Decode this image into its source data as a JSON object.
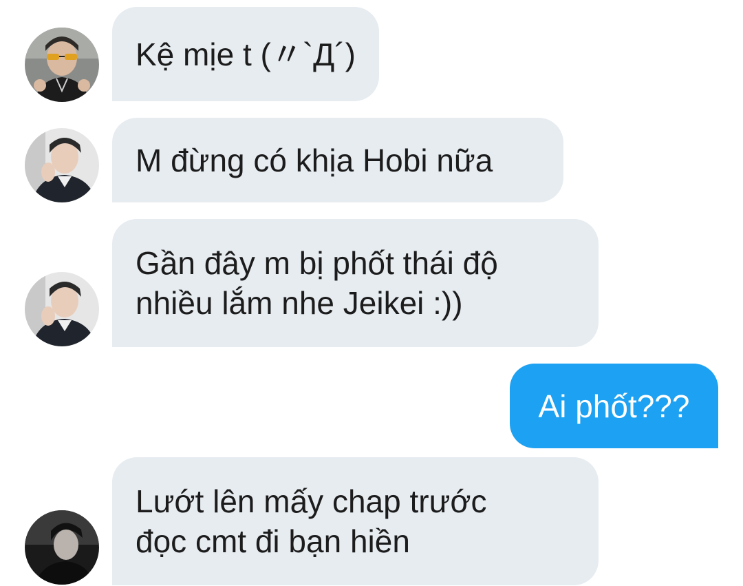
{
  "conversation": {
    "messages": [
      {
        "direction": "incoming",
        "avatar_icon": "avatar-user-glasses-icon",
        "text": "Kệ mịe t (〃`Д´)"
      },
      {
        "direction": "incoming",
        "avatar_icon": "avatar-user-suit-icon",
        "text": "M đừng có khịa Hobi nữa"
      },
      {
        "direction": "incoming",
        "avatar_icon": "avatar-user-suit-icon",
        "text": "Gần đây m bị phốt thái độ\nnhiều lắm nhe Jeikei :))"
      },
      {
        "direction": "outgoing",
        "text": "Ai phốt???"
      },
      {
        "direction": "incoming",
        "avatar_icon": "avatar-user-dark-icon",
        "text": "Lướt lên mấy chap trước\nđọc cmt đi bạn hiền"
      }
    ]
  },
  "colors": {
    "incoming_bubble": "#e7ecf1",
    "outgoing_bubble": "#1da1f2",
    "incoming_text": "#1c1c1c",
    "outgoing_text": "#ffffff"
  }
}
